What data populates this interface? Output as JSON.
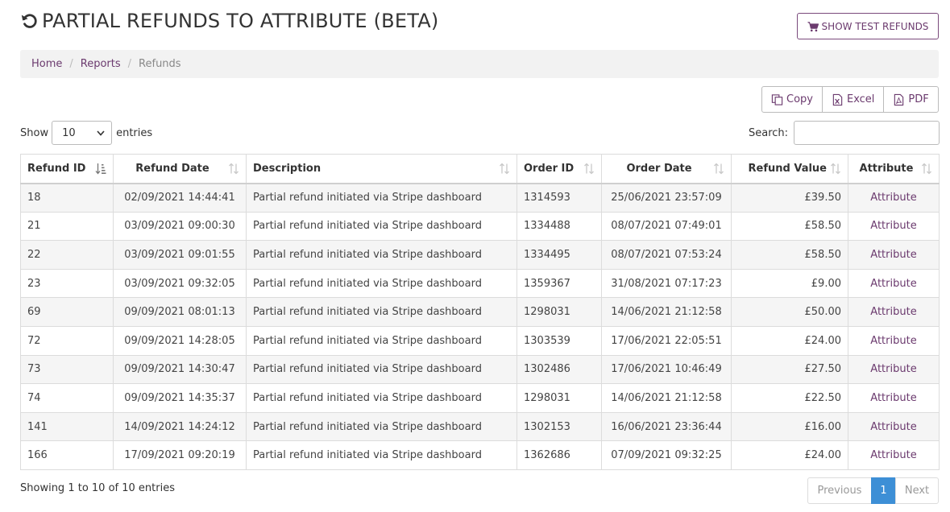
{
  "header": {
    "title": "PARTIAL REFUNDS TO ATTRIBUTE (BETA)",
    "title_icon": "undo-icon",
    "test_button_label": "SHOW TEST REFUNDS",
    "test_button_icon": "shopping-cart-icon"
  },
  "breadcrumb": {
    "items": [
      "Home",
      "Reports"
    ],
    "active": "Refunds",
    "separator": "/"
  },
  "export": {
    "copy": "Copy",
    "excel": "Excel",
    "pdf": "PDF"
  },
  "length": {
    "prefix": "Show",
    "value": "10",
    "suffix": "entries"
  },
  "search": {
    "label": "Search:",
    "value": ""
  },
  "table": {
    "columns": [
      "Refund ID",
      "Refund Date",
      "Description",
      "Order ID",
      "Order Date",
      "Refund Value",
      "Attribute"
    ],
    "rows": [
      [
        "18",
        "02/09/2021 14:44:41",
        "Partial refund initiated via Stripe dashboard",
        "1314593",
        "25/06/2021 23:57:09",
        "£39.50",
        "Attribute"
      ],
      [
        "21",
        "03/09/2021 09:00:30",
        "Partial refund initiated via Stripe dashboard",
        "1334488",
        "08/07/2021 07:49:01",
        "£58.50",
        "Attribute"
      ],
      [
        "22",
        "03/09/2021 09:01:55",
        "Partial refund initiated via Stripe dashboard",
        "1334495",
        "08/07/2021 07:53:24",
        "£58.50",
        "Attribute"
      ],
      [
        "23",
        "03/09/2021 09:32:05",
        "Partial refund initiated via Stripe dashboard",
        "1359367",
        "31/08/2021 07:17:23",
        "£9.00",
        "Attribute"
      ],
      [
        "69",
        "09/09/2021 08:01:13",
        "Partial refund initiated via Stripe dashboard",
        "1298031",
        "14/06/2021 21:12:58",
        "£50.00",
        "Attribute"
      ],
      [
        "72",
        "09/09/2021 14:28:05",
        "Partial refund initiated via Stripe dashboard",
        "1303539",
        "17/06/2021 22:05:51",
        "£24.00",
        "Attribute"
      ],
      [
        "73",
        "09/09/2021 14:30:47",
        "Partial refund initiated via Stripe dashboard",
        "1302486",
        "17/06/2021 10:46:49",
        "£27.50",
        "Attribute"
      ],
      [
        "74",
        "09/09/2021 14:35:37",
        "Partial refund initiated via Stripe dashboard",
        "1298031",
        "14/06/2021 21:12:58",
        "£22.50",
        "Attribute"
      ],
      [
        "141",
        "14/09/2021 14:24:12",
        "Partial refund initiated via Stripe dashboard",
        "1302153",
        "16/06/2021 23:36:44",
        "£16.00",
        "Attribute"
      ],
      [
        "166",
        "17/09/2021 09:20:19",
        "Partial refund initiated via Stripe dashboard",
        "1362686",
        "07/09/2021 09:32:25",
        "£24.00",
        "Attribute"
      ]
    ]
  },
  "footer": {
    "info": "Showing 1 to 10 of 10 entries",
    "previous": "Previous",
    "current_page": "1",
    "next": "Next"
  },
  "colors": {
    "accent": "#6b3a6e",
    "page_active": "#3d8fd6",
    "row_stripe": "#f5f5f5"
  }
}
